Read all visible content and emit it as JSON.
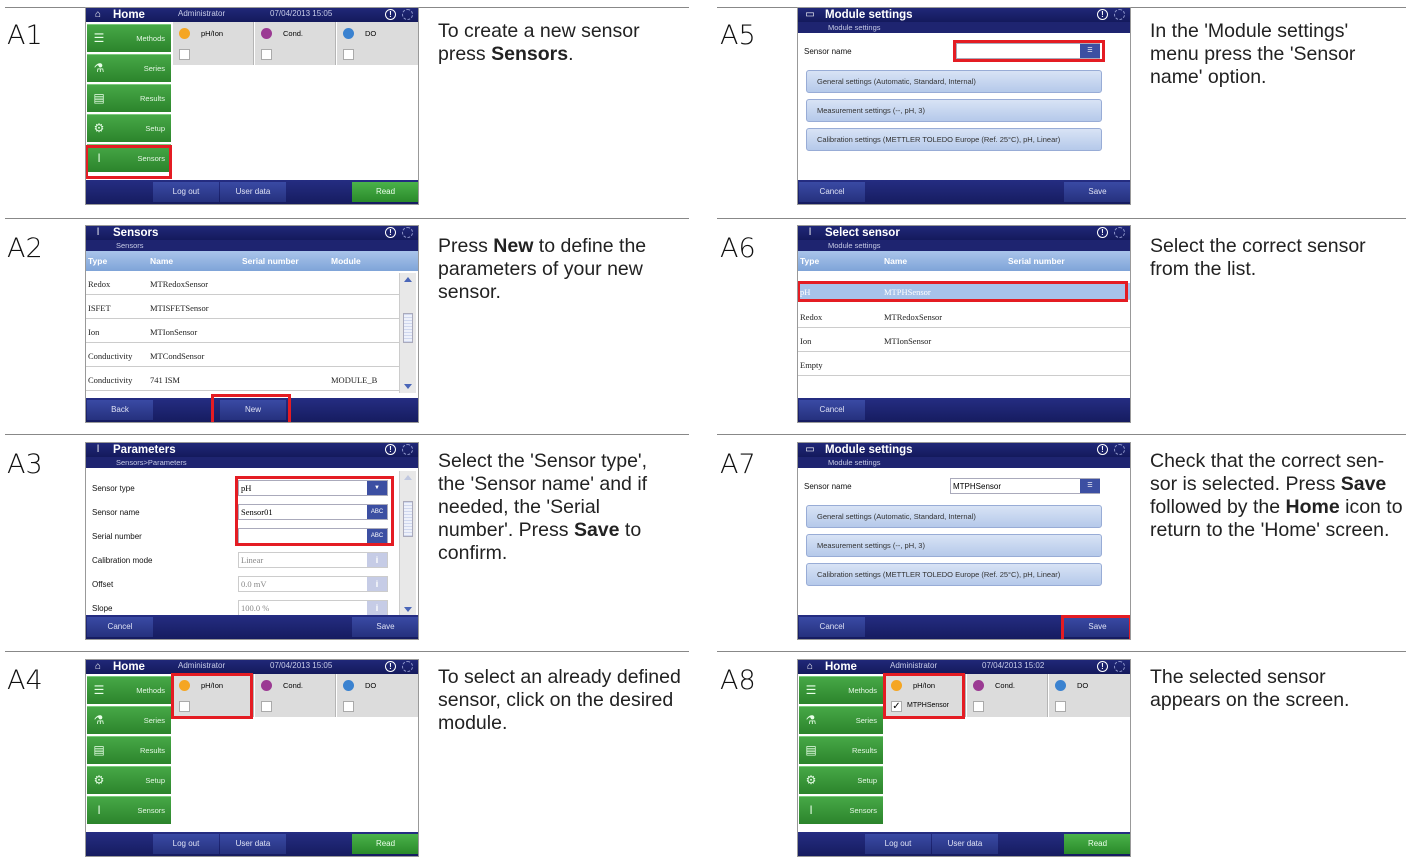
{
  "labels": {
    "a1": "A1",
    "a2": "A2",
    "a3": "A3",
    "a4": "A4",
    "a5": "A5",
    "a6": "A6",
    "a7": "A7",
    "a8": "A8"
  },
  "desc": {
    "a1": {
      "pre": "To create a new sensor press ",
      "b1": "Sensors",
      "post": "."
    },
    "a2": {
      "pre": "Press ",
      "b1": "New",
      "post": " to define the parameters of your new sensor."
    },
    "a3": {
      "pre": "Select the 'Sensor type', the 'Sensor name' and if needed, the 'Serial number'. Press ",
      "b1": "Save",
      "post": " to confirm."
    },
    "a4": {
      "text": "To select an already defined sensor, click on the desired module."
    },
    "a5": {
      "text": "In the 'Module settings' menu press the 'Sensor name' option."
    },
    "a6": {
      "text": "Select the correct sensor from the list."
    },
    "a7": {
      "pre": "Check that the correct sen-sor is selected. Press ",
      "b1": "Save",
      "mid": " followed by the ",
      "b2": "Home",
      "post": " icon to return to the 'Home' screen."
    },
    "a8": {
      "text": "The selected sensor appears on the screen."
    }
  },
  "home": {
    "title": "Home",
    "admin": "Administrator",
    "date_a1": "07/04/2013 15:05",
    "date_a8": "07/04/2013 15:02",
    "side": [
      "Methods",
      "Series",
      "Results",
      "Setup",
      "Sensors"
    ],
    "modules": [
      "pH/Ion",
      "Cond.",
      "DO"
    ],
    "module_colors": [
      "#f5a623",
      "#9b3a93",
      "#3a82d0"
    ],
    "sensor_a8": "MTPHSensor",
    "logout": "Log out",
    "userdata": "User data",
    "read": "Read"
  },
  "sensors": {
    "title": "Sensors",
    "sub": "Sensors",
    "cols": [
      "Type",
      "Name",
      "Serial number",
      "Module"
    ],
    "rows": [
      {
        "type": "Redox",
        "name": "MTRedoxSensor",
        "module": ""
      },
      {
        "type": "ISFET",
        "name": "MTISFETSensor",
        "module": ""
      },
      {
        "type": "Ion",
        "name": "MTIonSensor",
        "module": ""
      },
      {
        "type": "Conductivity",
        "name": "MTCondSensor",
        "module": ""
      },
      {
        "type": "Conductivity",
        "name": "741 ISM",
        "module": "MODULE_B"
      }
    ],
    "back": "Back",
    "new": "New"
  },
  "params": {
    "title": "Parameters",
    "sub": "Sensors>Parameters",
    "fields": [
      {
        "label": "Sensor type",
        "value": "pH"
      },
      {
        "label": "Sensor name",
        "value": "Sensor01"
      },
      {
        "label": "Serial number",
        "value": ""
      },
      {
        "label": "Calibration mode",
        "value": "Linear"
      },
      {
        "label": "Offset",
        "value": "0.0 mV"
      },
      {
        "label": "Slope",
        "value": "100.0 %"
      }
    ],
    "abc": "ABC",
    "info": "i",
    "cancel": "Cancel",
    "save": "Save"
  },
  "modset": {
    "title": "Module settings",
    "sub": "Module settings",
    "sensor_label": "Sensor name",
    "sensor_a7": "MTPHSensor",
    "buttons": [
      "General settings (Automatic, Standard, Internal)",
      "Measurement settings (--, pH, 3)",
      "Calibration settings (METTLER TOLEDO Europe (Ref. 25°C), pH, Linear)"
    ],
    "cancel": "Cancel",
    "save": "Save"
  },
  "select": {
    "title": "Select sensor",
    "sub": "Module settings",
    "cols": [
      "Type",
      "Name",
      "Serial number"
    ],
    "rows": [
      {
        "type": "pH",
        "name": "MTPHSensor"
      },
      {
        "type": "Redox",
        "name": "MTRedoxSensor"
      },
      {
        "type": "Ion",
        "name": "MTIonSensor"
      },
      {
        "type": "Empty",
        "name": ""
      }
    ],
    "cancel": "Cancel"
  }
}
